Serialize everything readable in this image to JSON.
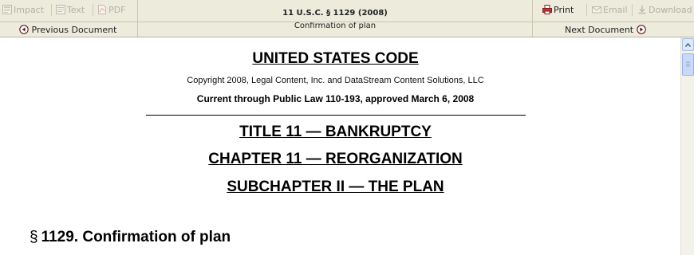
{
  "toolbar": {
    "impact_label": "Impact",
    "text_label": "Text",
    "pdf_label": "PDF",
    "print_label": "Print",
    "email_label": "Email",
    "download_label": "Download",
    "previous_label": "Previous Document",
    "next_label": "Next Document"
  },
  "document_header": {
    "citation": "11 U.S.C. § 1129 (2008)",
    "title": "Confirmation of plan"
  },
  "document": {
    "code_title": "UNITED STATES CODE",
    "copyright": "Copyright 2008, Legal Content, Inc. and DataStream Content Solutions, LLC",
    "currency": "Current through Public Law 110-193, approved March 6, 2008",
    "title_line": "TITLE 11 — BANKRUPTCY",
    "chapter_line": "CHAPTER 11 — REORGANIZATION",
    "subchapter_line": "SUBCHAPTER II — THE PLAN",
    "section_symbol": "§",
    "section_heading": "1129. Confirmation of plan"
  },
  "icons": {
    "impact": "impact-icon",
    "text": "text-icon",
    "pdf": "pdf-icon",
    "print": "print-icon",
    "email": "email-icon",
    "download": "download-icon",
    "previous": "arrow-left-circle-icon",
    "next": "arrow-right-circle-icon"
  },
  "colors": {
    "toolbar_bg": "#ecebdc",
    "disabled_text": "#b4b2a2",
    "print_icon": "#8a1a1a",
    "scroll_thumb": "#c9d9f7"
  }
}
